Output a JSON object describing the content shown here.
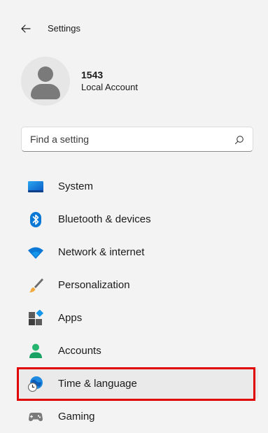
{
  "header": {
    "title": "Settings",
    "back_icon": "arrow-left-icon"
  },
  "profile": {
    "name": "1543",
    "account_type": "Local Account"
  },
  "search": {
    "placeholder": "Find a setting",
    "value": "",
    "icon": "search-icon"
  },
  "nav": {
    "items": [
      {
        "label": "System",
        "icon": "monitor-icon",
        "selected": false
      },
      {
        "label": "Bluetooth & devices",
        "icon": "bluetooth-icon",
        "selected": false
      },
      {
        "label": "Network & internet",
        "icon": "wifi-icon",
        "selected": false
      },
      {
        "label": "Personalization",
        "icon": "brush-icon",
        "selected": false
      },
      {
        "label": "Apps",
        "icon": "apps-icon",
        "selected": false
      },
      {
        "label": "Accounts",
        "icon": "person-icon",
        "selected": false
      },
      {
        "label": "Time & language",
        "icon": "globe-clock-icon",
        "selected": true
      },
      {
        "label": "Gaming",
        "icon": "gamepad-icon",
        "selected": false
      }
    ]
  },
  "colors": {
    "accent": "#005fb8",
    "highlight_box": "#e00000",
    "window_bg": "#f3f3f3"
  }
}
